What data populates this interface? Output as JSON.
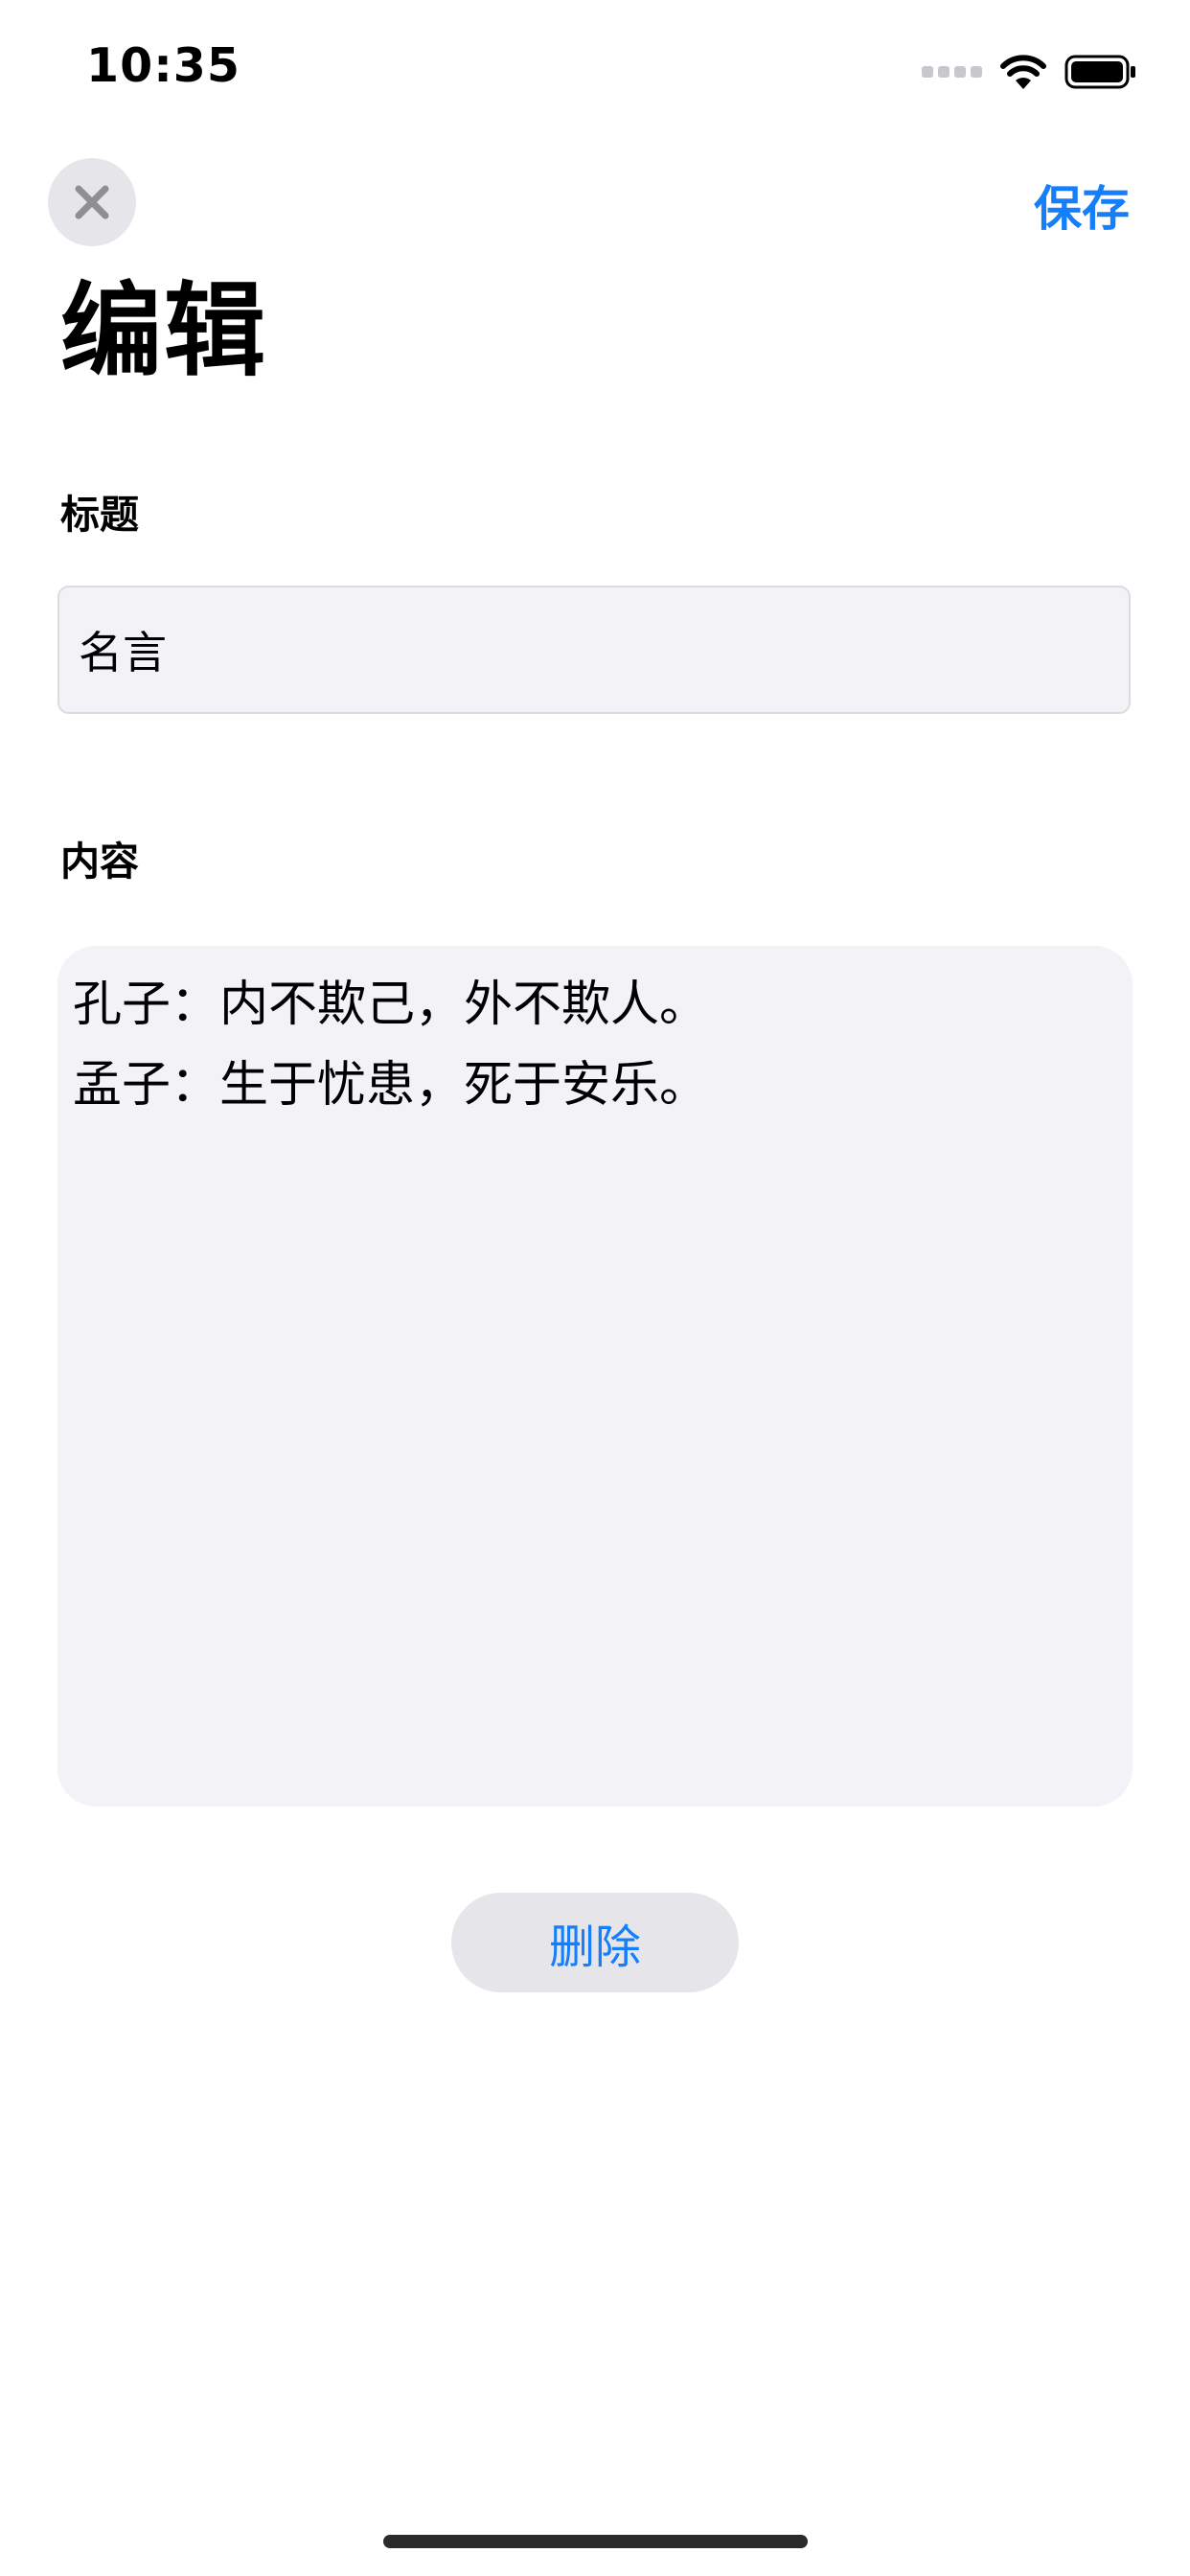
{
  "status_bar": {
    "time": "10:35",
    "icons": [
      "cellular-signal-icon",
      "wifi-icon",
      "battery-icon"
    ]
  },
  "nav": {
    "close_icon": "close-icon",
    "save_label": "保存"
  },
  "page": {
    "title": "编辑"
  },
  "form": {
    "title_label": "标题",
    "title_value": "名言",
    "content_label": "内容",
    "content_value": "孔子：内不欺己，外不欺人。\n孟子：生于忧患，死于安乐。"
  },
  "actions": {
    "delete_label": "删除"
  },
  "colors": {
    "accent": "#147efb",
    "field_background": "#f2f2f7",
    "button_background": "#e5e5ea"
  }
}
